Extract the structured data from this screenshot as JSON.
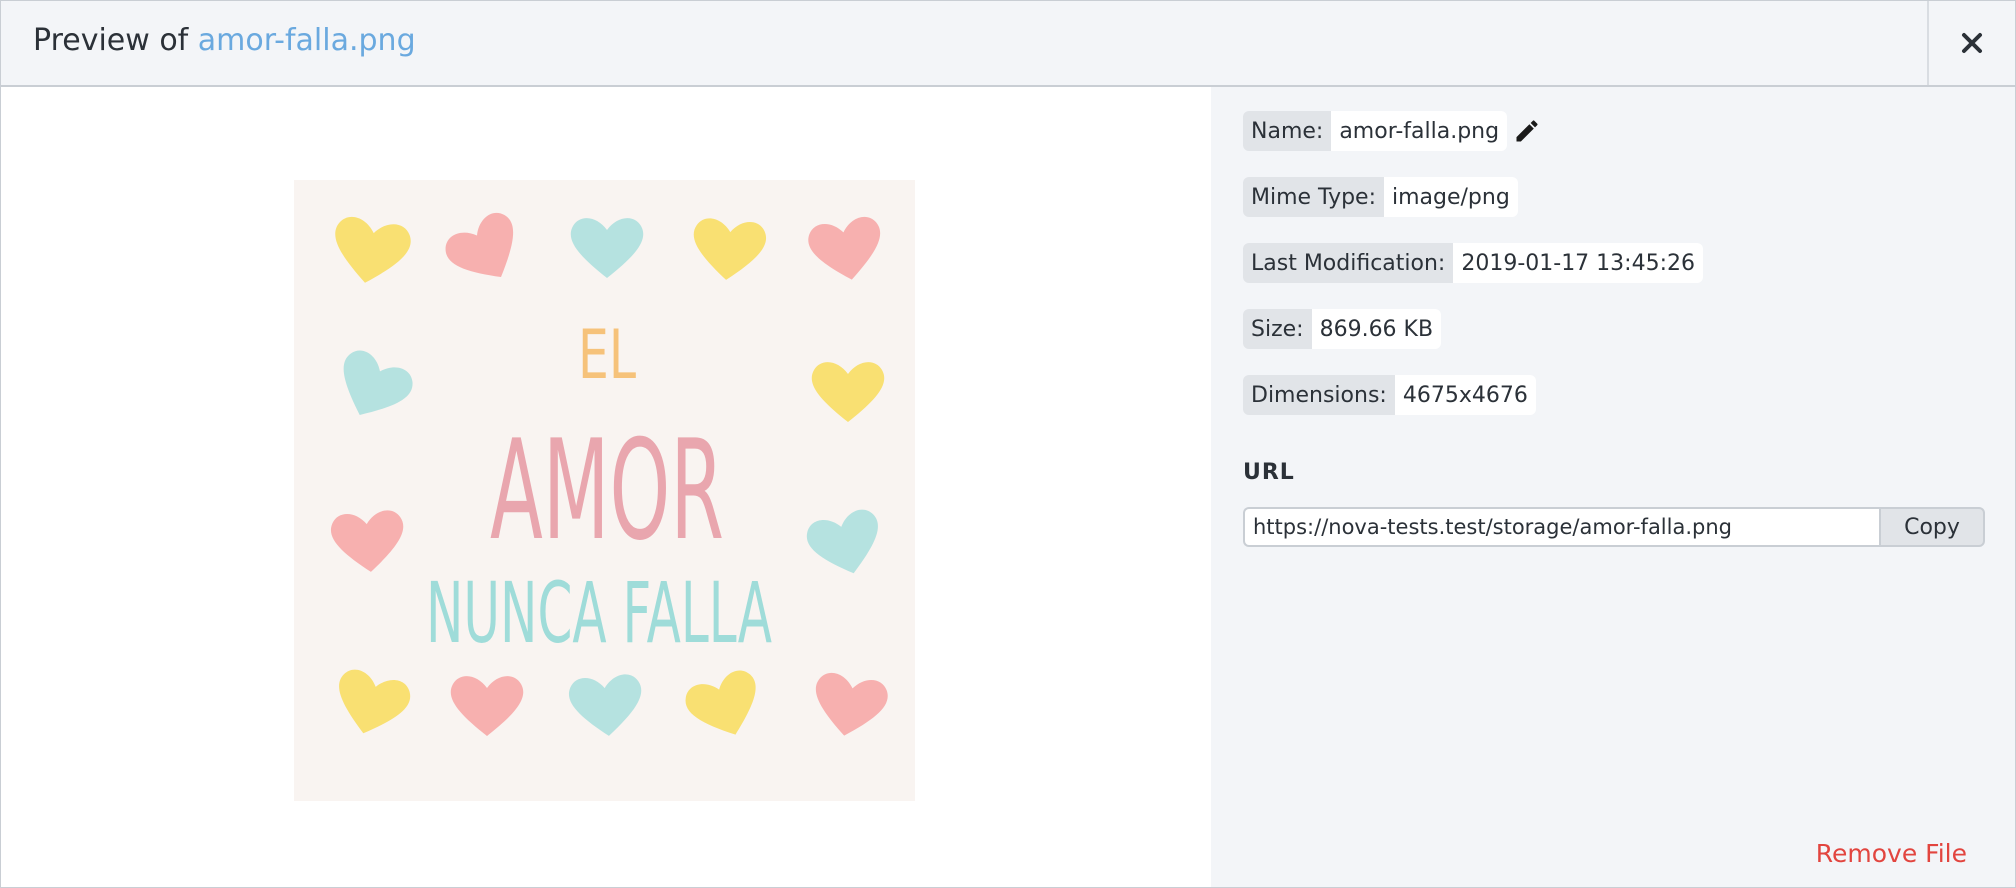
{
  "header": {
    "title_prefix": "Preview of",
    "file_name": "amor-falla.png"
  },
  "close_icon": "close-icon",
  "preview_image": {
    "line1": "EL",
    "line2": "AMOR",
    "line3": "NUNCA FALLA"
  },
  "metadata": [
    {
      "label": "Name:",
      "value": "amor-falla.png",
      "editable": true
    },
    {
      "label": "Mime Type:",
      "value": "image/png"
    },
    {
      "label": "Last Modification:",
      "value": "2019-01-17 13:45:26"
    },
    {
      "label": "Size:",
      "value": "869.66 KB"
    },
    {
      "label": "Dimensions:",
      "value": "4675x4676"
    }
  ],
  "url": {
    "label": "URL",
    "value": "https://nova-tests.test/storage/amor-falla.png",
    "copy_label": "Copy"
  },
  "remove_label": "Remove File",
  "colors": {
    "link": "#6aa9df",
    "danger": "#e2453f",
    "panel_bg": "#f3f5f8",
    "heart_yellow": "#f9dc5c",
    "heart_pink": "#f7a3a3",
    "heart_teal": "#a9dedd",
    "text_orange": "#f6c27a",
    "text_pink": "#e9a6ae",
    "text_teal": "#9fdcd9"
  }
}
